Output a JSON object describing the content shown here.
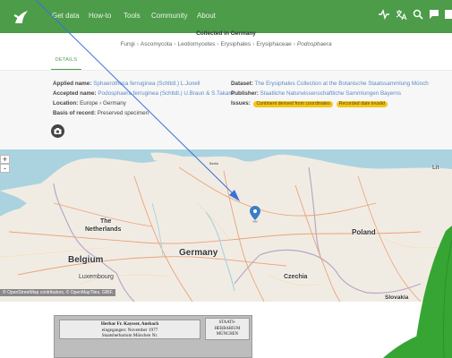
{
  "nav": {
    "items": [
      "Get data",
      "How-to",
      "Tools",
      "Community",
      "About"
    ],
    "icons": [
      "analytics-icon",
      "translate-icon",
      "search-icon",
      "chat-icon",
      "menu-icon"
    ]
  },
  "header": {
    "collected": "Collected in Germany",
    "taxonomy": [
      "Fungi",
      "Ascomycota",
      "Leotiomycetes",
      "Erysiphales",
      "Erysiphaceae",
      "Podosphaera"
    ]
  },
  "tab": {
    "label": "DETAILS"
  },
  "details": {
    "applied_label": "Applied name:",
    "applied_value": "Sphaerotheca ferruginea (Schltdl.) L.Junell",
    "accepted_label": "Accepted name:",
    "accepted_value": "Podosphaera ferruginea (Schltdl.) U.Braun & S.Takam.",
    "location_label": "Location:",
    "location_value": "Europe › Germany",
    "basis_label": "Basis of record:",
    "basis_value": "Preserved specimen",
    "dataset_label": "Dataset:",
    "dataset_value": "The Erysiphales Collection at the Botanische Staatssammlung Münch",
    "publisher_label": "Publisher:",
    "publisher_value": "Staatliche Naturwissenschaftliche Sammlungen Bayerns",
    "issues_label": "Issues:",
    "issues": [
      "Continent derived from coordinates",
      "Recorded date invalid"
    ]
  },
  "map": {
    "zoom_in": "+",
    "zoom_out": "-",
    "places": {
      "netherlands_1": "The",
      "netherlands_2": "Netherlands",
      "belgium": "Belgium",
      "luxembourg": "Luxembourg",
      "germany": "Germany",
      "poland": "Poland",
      "czechia": "Czechia",
      "lit": "Lit",
      "slovakia": "Slovakia",
      "berlin": "Berlin"
    },
    "attribution": "© OpenStreetMap contributors, © OpenMapTiles, GBIF."
  },
  "specimen": {
    "line1": "Herbar Fr. Kaysser, Ansbach",
    "line2": "eingegangen: November 1977",
    "line3": "Staatsherbarium München Nr.",
    "stamp1": "STAATS-",
    "stamp2": "HERBARIUM",
    "stamp3": "MÜNCHEN"
  },
  "colors": {
    "nav": "#4c9c4a",
    "link": "#5c8bc6",
    "badge": "#f5c51a",
    "marker": "#3a7dc9",
    "sprout": "#36a534"
  }
}
